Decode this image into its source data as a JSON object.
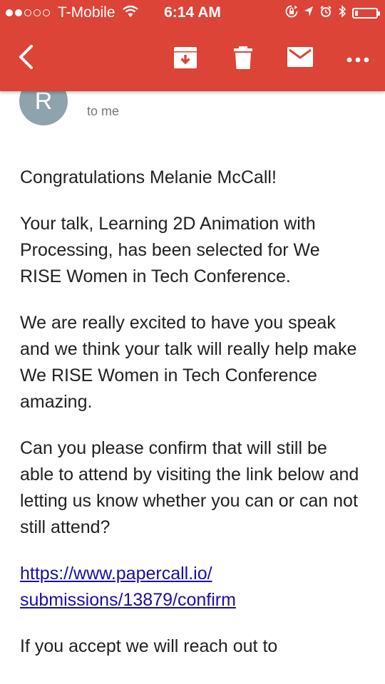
{
  "status_bar": {
    "carrier": "T-Mobile",
    "time": "6:14 AM",
    "signal_bars_filled": 2,
    "signal_bars_total": 5,
    "battery_level_fraction": 0.15
  },
  "toolbar": {
    "icons": [
      "back-arrow-icon",
      "archive-icon",
      "delete-icon",
      "mail-icon",
      "more-options-icon"
    ]
  },
  "email": {
    "avatar_letter": "R",
    "recipient_label": "to me",
    "paragraphs": [
      "Congratulations Melanie McCall!",
      "Your talk, Learning 2D Animation with Processing, has been selected for We RISE Women in Tech Conference.",
      "We are really excited to have you speak and we think your talk will really help make We RISE Women in Tech Conference amazing.",
      "Can you please confirm that will still be able to attend by visiting the link below and letting us know whether you can or can not still attend?"
    ],
    "link_text": "https://www.papercall.io/submissions/13879/confirm",
    "last_paragraph": "If you accept we will reach out to"
  },
  "colors": {
    "header": "#db4437",
    "avatar": "#8fa3ad",
    "link": "#1a0dab"
  }
}
